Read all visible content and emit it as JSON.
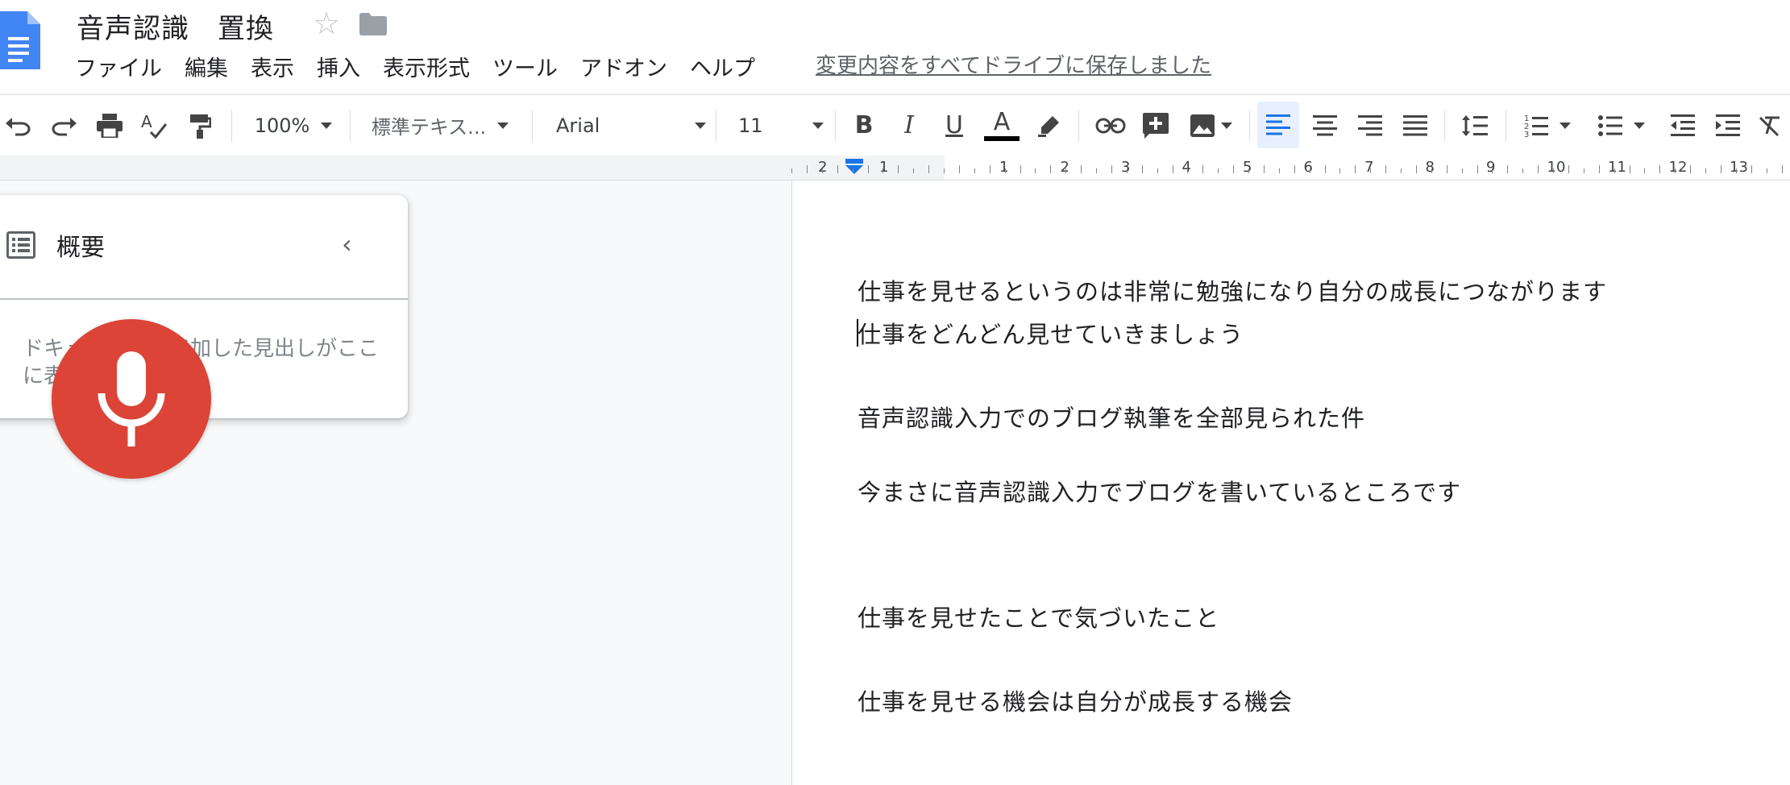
{
  "app": {
    "doc_title": "音声認識　置換",
    "icons": {
      "doc": "google-docs-icon",
      "star": "star-icon",
      "folder": "folder-icon"
    }
  },
  "menu": [
    "ファイル",
    "編集",
    "表示",
    "挿入",
    "表示形式",
    "ツール",
    "アドオン",
    "ヘルプ"
  ],
  "save_status": "変更内容をすべてドライブに保存しました",
  "toolbar": {
    "zoom": "100%",
    "style": "標準テキス...",
    "font": "Arial",
    "size": "11",
    "bold": "B",
    "italic": "I",
    "underline": "U",
    "text_color_letter": "A",
    "accent_color": "#1a73e8"
  },
  "ruler": {
    "numbers": [
      "2",
      "1",
      "1",
      "2",
      "3",
      "4",
      "5",
      "6",
      "7",
      "8",
      "9",
      "10",
      "11",
      "12",
      "13"
    ]
  },
  "outline": {
    "title": "概要",
    "hint": "ドキュメントに追加した見出しがここに表示されます。"
  },
  "mic": {
    "color": "#db4437",
    "icon": "microphone-icon"
  },
  "document": {
    "lines": [
      "仕事を見せるというのは非常に勉強になり自分の成長につながります",
      "仕事をどんどん見せていきましょう",
      "音声認識入力でのブログ執筆を全部見られた件",
      "今まさに音声認識入力でブログを書いているところです",
      "仕事を見せたことで気づいたこと",
      "仕事を見せる機会は自分が成長する機会"
    ]
  }
}
